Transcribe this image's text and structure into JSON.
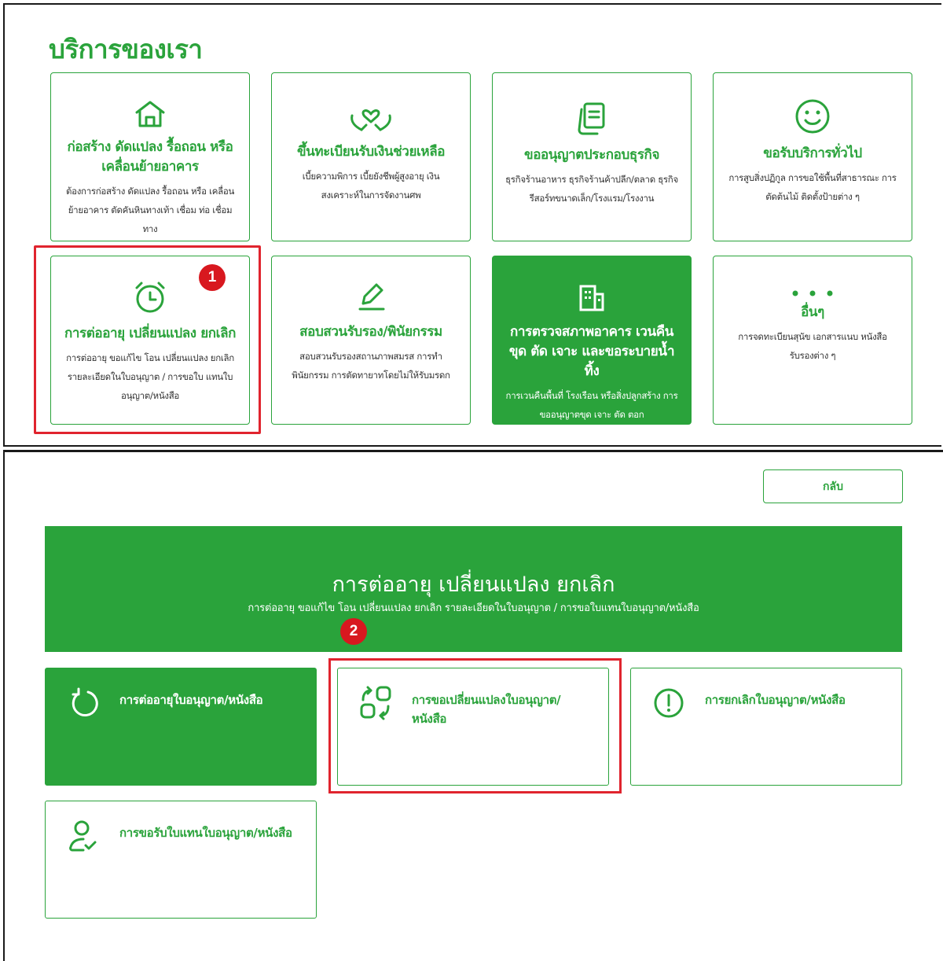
{
  "colors": {
    "brand_green": "#2aa33b",
    "highlight_red": "#e0242e",
    "badge_red": "#d8181f"
  },
  "services": {
    "title": "บริการของเรา",
    "cards": [
      {
        "icon": "home-icon",
        "title": "ก่อสร้าง ดัดแปลง รื้อถอน หรือเคลื่อนย้ายอาคาร",
        "desc": "ต้องการก่อสร้าง ดัดแปลง รื้อถอน หรือ เคลื่อนย้ายอาคาร ตัดคันหินทางเท้า เชื่อม ท่อ เชื่อมทาง"
      },
      {
        "icon": "hands-heart-icon",
        "title": "ขึ้นทะเบียนรับเงินช่วยเหลือ",
        "desc": "เบี้ยความพิการ เบี้ยยังชีพผู้สูงอายุ เงิน สงเคราะห์ในการจัดงานศพ"
      },
      {
        "icon": "documents-icon",
        "title": "ขออนุญาตประกอบธุรกิจ",
        "desc": "ธุรกิจร้านอาหาร ธุรกิจร้านค้าปลีก/ตลาด ธุรกิจรีสอร์ทขนาดเล็ก/โรงแรม/โรงงาน"
      },
      {
        "icon": "smiley-icon",
        "title": "ขอรับบริการทั่วไป",
        "desc": "การสูบสิ่งปฏิกูล การขอใช้พื้นที่สาธารณะ การตัดต้นไม้ ติดตั้งป้ายต่าง ๆ"
      },
      {
        "icon": "alarm-clock-icon",
        "title": "การต่ออายุ เปลี่ยนแปลง ยกเลิก",
        "desc": "การต่ออายุ ขอแก้ไข โอน เปลี่ยนแปลง ยกเลิก รายละเอียดในใบอนุญาต / การขอใบ แทนใบอนุญาต/หนังสือ"
      },
      {
        "icon": "pencil-icon",
        "title": "สอบสวนรับรอง/พินัยกรรม",
        "desc": "สอบสวนรับรองสถานภาพสมรส การทำ พินัยกรรม การตัดทายาทโดยไม่ให้รับมรดก"
      },
      {
        "icon": "building-icon",
        "title": "การตรวจสภาพอาคาร เวนคืน ขุด ตัด เจาะ และขอระบายน้ำทิ้ง",
        "desc": "การเวนคืนพื้นที่ โรงเรือน หรือสิ่งปลูกสร้าง การขออนุญาตขุด เจาะ ตัด ตอก"
      },
      {
        "icon": "more-dots-icon",
        "title": "อื่นๆ",
        "desc": "การจดทะเบียนสุนัข เอกสารแนบ หนังสือ รับรองต่าง ๆ"
      }
    ]
  },
  "badges": {
    "step1": "1",
    "step2": "2"
  },
  "detail": {
    "back_label": "กลับ",
    "banner_title": "การต่ออายุ เปลี่ยนแปลง ยกเลิก",
    "banner_subtitle": "การต่ออายุ ขอแก้ไข โอน เปลี่ยนแปลง ยกเลิก รายละเอียดในใบอนุญาต / การขอใบแทนใบอนุญาต/หนังสือ",
    "options": [
      {
        "icon": "renew-icon",
        "label": "การต่ออายุใบอนุญาต/หนังสือ"
      },
      {
        "icon": "swap-icon",
        "label": "การขอเปลี่ยนแปลงใบอนุญาต/ หนังสือ"
      },
      {
        "icon": "alert-icon",
        "label": "การยกเลิกใบอนุญาต/หนังสือ"
      },
      {
        "icon": "user-check-icon",
        "label": "การขอรับใบแทนใบอนุญาต/หนังสือ"
      }
    ]
  }
}
